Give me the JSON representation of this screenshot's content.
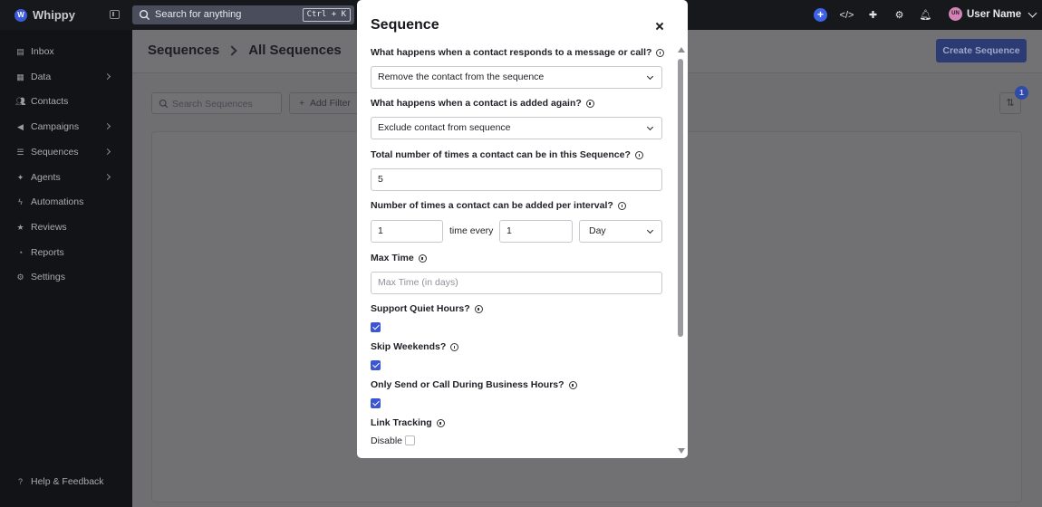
{
  "app": {
    "name": "Whippy"
  },
  "topbar": {
    "search_placeholder": "Search for anything",
    "shortcut": "Ctrl + K",
    "user_initials": "UN",
    "user_name": "User Name",
    "icons": [
      "plus-icon",
      "code-icon",
      "puzzle-icon",
      "gear-icon",
      "bell-icon"
    ]
  },
  "sidebar": {
    "items": [
      {
        "label": "Inbox",
        "icon": "inbox-icon",
        "has_submenu": false
      },
      {
        "label": "Data",
        "icon": "database-icon",
        "has_submenu": true
      },
      {
        "label": "Contacts",
        "icon": "contacts-icon",
        "has_submenu": false
      },
      {
        "label": "Campaigns",
        "icon": "megaphone-icon",
        "has_submenu": true
      },
      {
        "label": "Sequences",
        "icon": "sequence-icon",
        "has_submenu": true
      },
      {
        "label": "Agents",
        "icon": "agent-icon",
        "has_submenu": true
      },
      {
        "label": "Automations",
        "icon": "bolt-icon",
        "has_submenu": false
      },
      {
        "label": "Reviews",
        "icon": "star-icon",
        "has_submenu": false
      },
      {
        "label": "Reports",
        "icon": "chart-icon",
        "has_submenu": false
      },
      {
        "label": "Settings",
        "icon": "gear-icon",
        "has_submenu": false
      }
    ],
    "help_label": "Help & Feedback"
  },
  "main": {
    "breadcrumb_parent": "Sequences",
    "breadcrumb_current": "All Sequences",
    "create_button": "Create Sequence",
    "search_placeholder": "Search Sequences",
    "add_filter": "Add Filter",
    "sort_badge": "1"
  },
  "modal": {
    "title": "Sequence",
    "q_responds": "What happens when a contact responds to a message or call?",
    "responds_value": "Remove the contact from the sequence",
    "q_added_again": "What happens when a contact is added again?",
    "added_again_value": "Exclude contact from sequence",
    "q_total_times": "Total number of times a contact can be in this Sequence?",
    "total_times_value": "5",
    "q_per_interval": "Number of times a contact can be added per interval?",
    "interval_count": "1",
    "time_every": "time every",
    "interval_length": "1",
    "interval_unit": "Day",
    "max_time_label": "Max Time",
    "max_time_placeholder": "Max Time (in days)",
    "quiet_hours_label": "Support Quiet Hours?",
    "quiet_hours_checked": true,
    "skip_weekends_label": "Skip Weekends?",
    "skip_weekends_checked": true,
    "business_hours_label": "Only Send or Call During Business Hours?",
    "business_hours_checked": true,
    "link_tracking_label": "Link Tracking",
    "disable_label": "Disable",
    "disable_checked": false
  },
  "colors": {
    "accent": "#3c55d2",
    "sidebar_bg": "#121317",
    "topbar_bg": "#17181c",
    "overlay": "#6f6f72"
  }
}
